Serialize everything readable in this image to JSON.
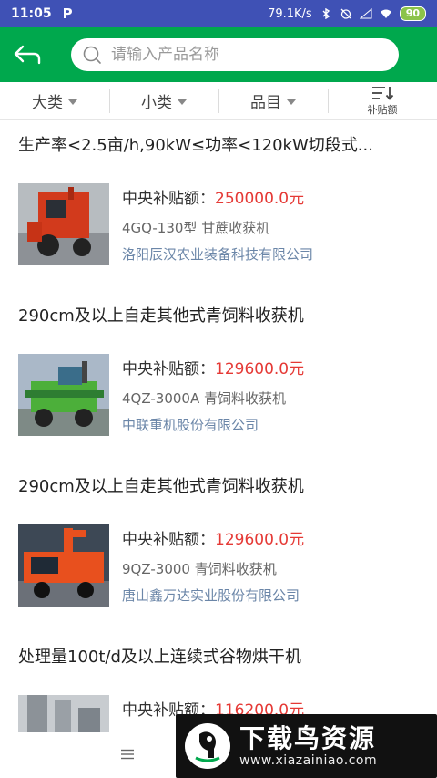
{
  "status_bar": {
    "time": "11:05",
    "app_icon": "P",
    "network_speed": "79.1K/s",
    "battery": "90",
    "icons": [
      "bluetooth-icon",
      "alarm-off-icon",
      "signal-icon",
      "wifi-icon",
      "battery-icon"
    ]
  },
  "header": {
    "back_icon": "back-arrow-icon",
    "search": {
      "placeholder": "请输入产品名称",
      "value": ""
    },
    "accent_color": "#00a84d"
  },
  "filters": {
    "category_label": "大类",
    "subcategory_label": "小类",
    "item_label": "品目",
    "sort_label": "补贴额"
  },
  "products": [
    {
      "title": "生产率<2.5亩/h,90kW≤功率<120kW切段式...",
      "subsidy_label": "中央补贴额：",
      "subsidy_value": "250000.0元",
      "model": "4GQ-130型 甘蔗收获机",
      "company": "洛阳辰汉农业装备科技有限公司"
    },
    {
      "title": "290cm及以上自走其他式青饲料收获机",
      "subsidy_label": "中央补贴额：",
      "subsidy_value": "129600.0元",
      "model": "4QZ-3000A 青饲料收获机",
      "company": "中联重机股份有限公司"
    },
    {
      "title": "290cm及以上自走其他式青饲料收获机",
      "subsidy_label": "中央补贴额：",
      "subsidy_value": "129600.0元",
      "model": "9QZ-3000 青饲料收获机",
      "company": "唐山鑫万达实业股份有限公司"
    },
    {
      "title": "处理量100t/d及以上连续式谷物烘干机",
      "subsidy_label": "中央补贴额：",
      "subsidy_value": "116200.0元",
      "model": "",
      "company": ""
    }
  ],
  "colors": {
    "status_bar": "#3f51b5",
    "header": "#00a84d",
    "price": "#e53935",
    "company": "#6b86a8"
  },
  "watermark": {
    "title": "下载鸟资源",
    "url": "www.xiazainiao.com"
  }
}
